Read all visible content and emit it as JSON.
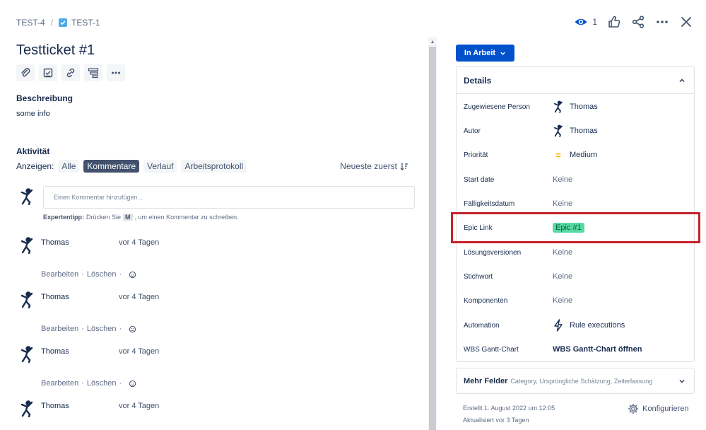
{
  "breadcrumb": {
    "parent": "TEST-4",
    "separator": "/",
    "current": "TEST-1"
  },
  "header": {
    "watch_count": "1"
  },
  "issue": {
    "title": "Testticket #1"
  },
  "description": {
    "label": "Beschreibung",
    "text": "some info"
  },
  "activity": {
    "label": "Aktivität",
    "show_label": "Anzeigen:",
    "filters": [
      "Alle",
      "Kommentare",
      "Verlauf",
      "Arbeitsprotokoll"
    ],
    "active_filter": "Kommentare",
    "sort_label": "Neueste zuerst",
    "comment_placeholder": "Einen Kommentar hinzufügen...",
    "tip_bold": "Expertentipp:",
    "tip_pre": "Drücken Sie",
    "tip_key": "M",
    "tip_post": ", um einen Kommentar zu schreiben.",
    "comments": [
      {
        "author": "Thomas",
        "time": "vor 4 Tagen"
      },
      {
        "author": "Thomas",
        "time": "vor 4 Tagen"
      },
      {
        "author": "Thomas",
        "time": "vor 4 Tagen"
      },
      {
        "author": "Thomas",
        "time": "vor 4 Tagen"
      }
    ],
    "edit_label": "Bearbeiten",
    "dot": "·",
    "delete_label": "Löschen"
  },
  "status": {
    "label": "In Arbeit"
  },
  "details": {
    "title": "Details",
    "rows": [
      {
        "label": "Zugewiesene Person",
        "value": "Thomas"
      },
      {
        "label": "Autor",
        "value": "Thomas"
      },
      {
        "label": "Priorität",
        "value": "Medium"
      },
      {
        "label": "Start date",
        "value": "Keine"
      },
      {
        "label": "Fälligkeitsdatum",
        "value": "Keine"
      },
      {
        "label": "Epic Link",
        "value": "Epic #1"
      },
      {
        "label": "Lösungsversionen",
        "value": "Keine"
      },
      {
        "label": "Stichwort",
        "value": "Keine"
      },
      {
        "label": "Komponenten",
        "value": "Keine"
      },
      {
        "label": "Automation",
        "value": "Rule executions"
      },
      {
        "label": "WBS Gantt-Chart",
        "value": "WBS Gantt-Chart öffnen"
      }
    ]
  },
  "more_fields": {
    "title": "Mehr Felder",
    "subtitle": "Category, Ursprüngliche Schätzung, Zeiterfassung"
  },
  "meta": {
    "created": "Erstellt 1. August 2022 um 12:05",
    "updated": "Aktualisiert vor 3 Tagen"
  },
  "configure_label": "Konfigurieren",
  "colors": {
    "primary": "#0052cc",
    "epic": "#57d9a3",
    "highlight": "#c8202a",
    "priority": "#ffab00"
  }
}
